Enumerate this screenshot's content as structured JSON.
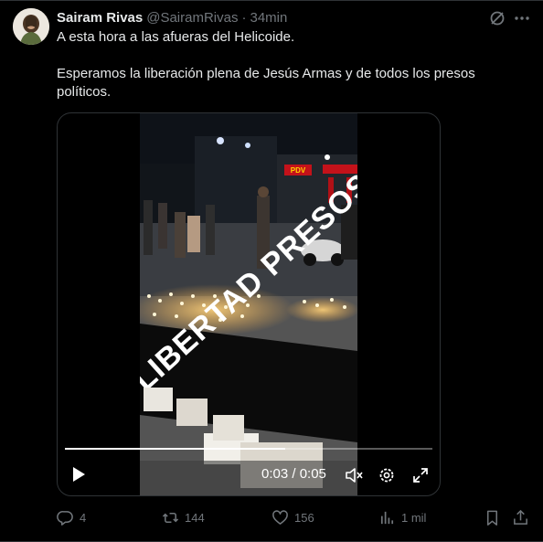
{
  "author": {
    "display_name": "Sairam Rivas",
    "handle": "@SairamRivas",
    "separator": "·",
    "time": "34min"
  },
  "tweet": {
    "line1": "A esta hora a las afueras del Helicoide.",
    "line2": "Esperamos la liberación plena de Jesús Armas y de todos los presos políticos."
  },
  "video": {
    "time_readout": "0:03 / 0:05",
    "progress": 0.6,
    "banner_text": "LIBERTAD PRESOS POLITICOS",
    "sign_text": "PDV"
  },
  "actions": {
    "replies": "4",
    "reposts": "144",
    "likes": "156",
    "views": "1 mil"
  },
  "icons": {
    "grok": "grok-icon",
    "more": "more-icon",
    "play": "play-icon",
    "mute": "mute-icon",
    "settings": "settings-icon",
    "fullscreen": "fullscreen-icon",
    "reply": "reply-icon",
    "repost": "repost-icon",
    "like": "like-icon",
    "views": "views-icon",
    "bookmark": "bookmark-icon",
    "share": "share-icon"
  }
}
